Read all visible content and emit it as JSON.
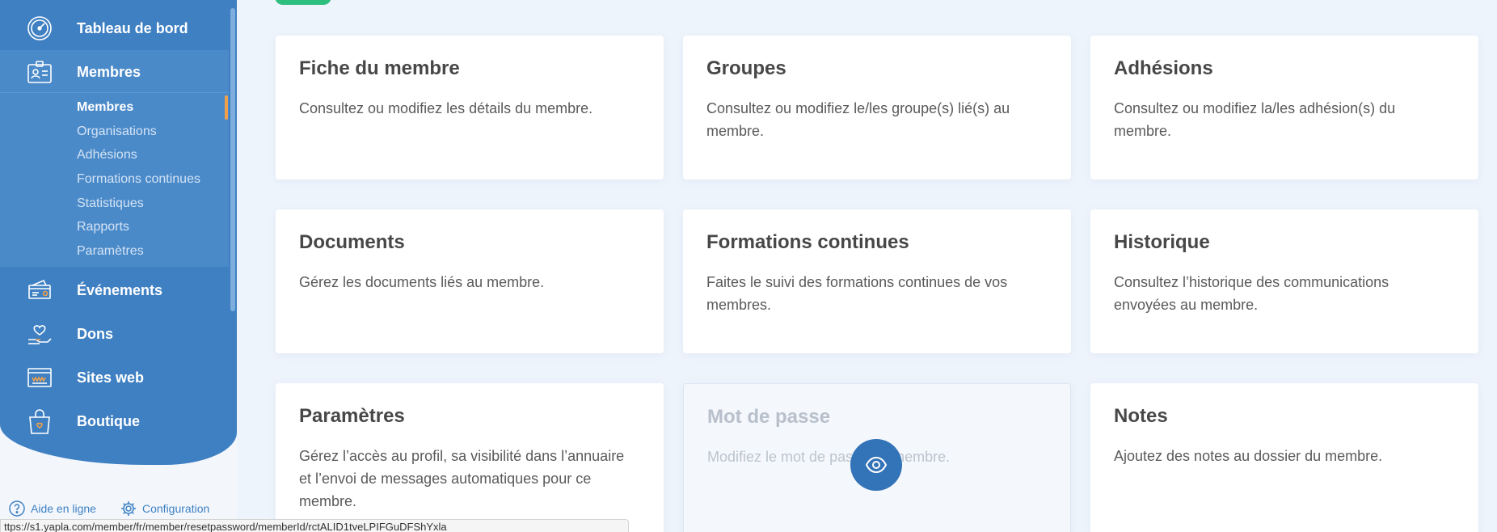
{
  "sidebar": {
    "items": [
      {
        "label": "Tableau de bord",
        "icon": "dashboard-gauge-icon"
      },
      {
        "label": "Membres",
        "icon": "member-id-card-icon"
      },
      {
        "label": "Événements",
        "icon": "event-ticket-icon"
      },
      {
        "label": "Dons",
        "icon": "donation-heart-hand-icon"
      },
      {
        "label": "Sites web",
        "icon": "website-browser-icon"
      },
      {
        "label": "Boutique",
        "icon": "shopping-bag-icon"
      }
    ],
    "submenu": [
      "Membres",
      "Organisations",
      "Adhésions",
      "Formations continues",
      "Statistiques",
      "Rapports",
      "Paramètres"
    ],
    "footer": {
      "help": "Aide en ligne",
      "config": "Configuration"
    }
  },
  "status_bar_url": "ttps://s1.yapla.com/member/fr/member/resetpassword/memberId/rctALID1tveLPIFGuDFShYxla",
  "cards": [
    {
      "title": "Fiche du membre",
      "desc": "Consultez ou modifiez les détails du membre."
    },
    {
      "title": "Groupes",
      "desc": "Consultez ou modifiez le/les groupe(s) lié(s) au membre."
    },
    {
      "title": "Adhésions",
      "desc": "Consultez ou modifiez la/les adhésion(s) du membre."
    },
    {
      "title": "Documents",
      "desc": "Gérez les documents liés au membre."
    },
    {
      "title": "Formations continues",
      "desc": "Faites le suivi des formations continues de vos membres."
    },
    {
      "title": "Historique",
      "desc": "Consultez l’historique des communications envoyées au membre."
    },
    {
      "title": "Paramètres",
      "desc": "Gérez l’accès au profil, sa visibilité dans l’annuaire et l’envoi de messages automatiques pour ce membre."
    },
    {
      "title": "Mot de passe",
      "desc": "Modifiez le mot de passe du membre."
    },
    {
      "title": "Notes",
      "desc": "Ajoutez des notes au dossier du membre."
    }
  ],
  "colors": {
    "sidebar_blue": "#3f80c3",
    "sidebar_active": "#4b8ac9",
    "accent_orange": "#f0a04b",
    "accent_green": "#2ebf7f",
    "eye_button": "#3373b8",
    "page_bg": "#eef4fc"
  }
}
